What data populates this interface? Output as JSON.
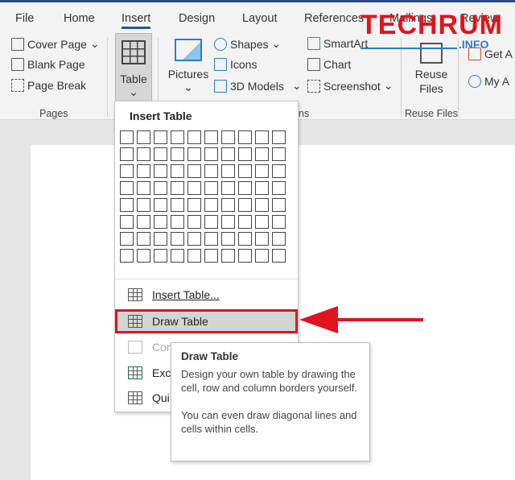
{
  "tabs": [
    "File",
    "Home",
    "Insert",
    "Design",
    "Layout",
    "References",
    "Mailings",
    "Review"
  ],
  "active_tab": "Insert",
  "pages_group": {
    "items": [
      "Cover Page",
      "Blank Page",
      "Page Break"
    ],
    "label": "Pages"
  },
  "table_button": "Table",
  "pictures_button": "Pictures",
  "illustrations": [
    "Shapes",
    "Icons",
    "3D Models"
  ],
  "illustrations_label_partial": "ns",
  "smart": [
    "SmartArt",
    "Chart",
    "Screenshot"
  ],
  "reuse": {
    "button": "Reuse Files",
    "label": "Reuse Files"
  },
  "addins": [
    "Get A",
    "My A"
  ],
  "watermark": {
    "main": "TECHRUM",
    "sub": ".INFO"
  },
  "menu": {
    "title": "Insert Table",
    "grid": {
      "columns": 10,
      "rows": 8
    },
    "items": [
      {
        "label": "Insert Table...",
        "state": "normal"
      },
      {
        "label": "Draw Table",
        "state": "highlighted"
      },
      {
        "label": "Con",
        "state": "disabled"
      },
      {
        "label": "Exce",
        "state": "normal"
      },
      {
        "label": "Qui",
        "state": "normal"
      }
    ]
  },
  "tooltip": {
    "title": "Draw Table",
    "line1": "Design your own table by drawing the cell, row and column borders yourself.",
    "line2": "You can even draw diagonal lines and cells within cells."
  },
  "colors": {
    "accent": "#2b579a",
    "highlight_border": "#e0141c",
    "arrow": "#e0141c"
  }
}
